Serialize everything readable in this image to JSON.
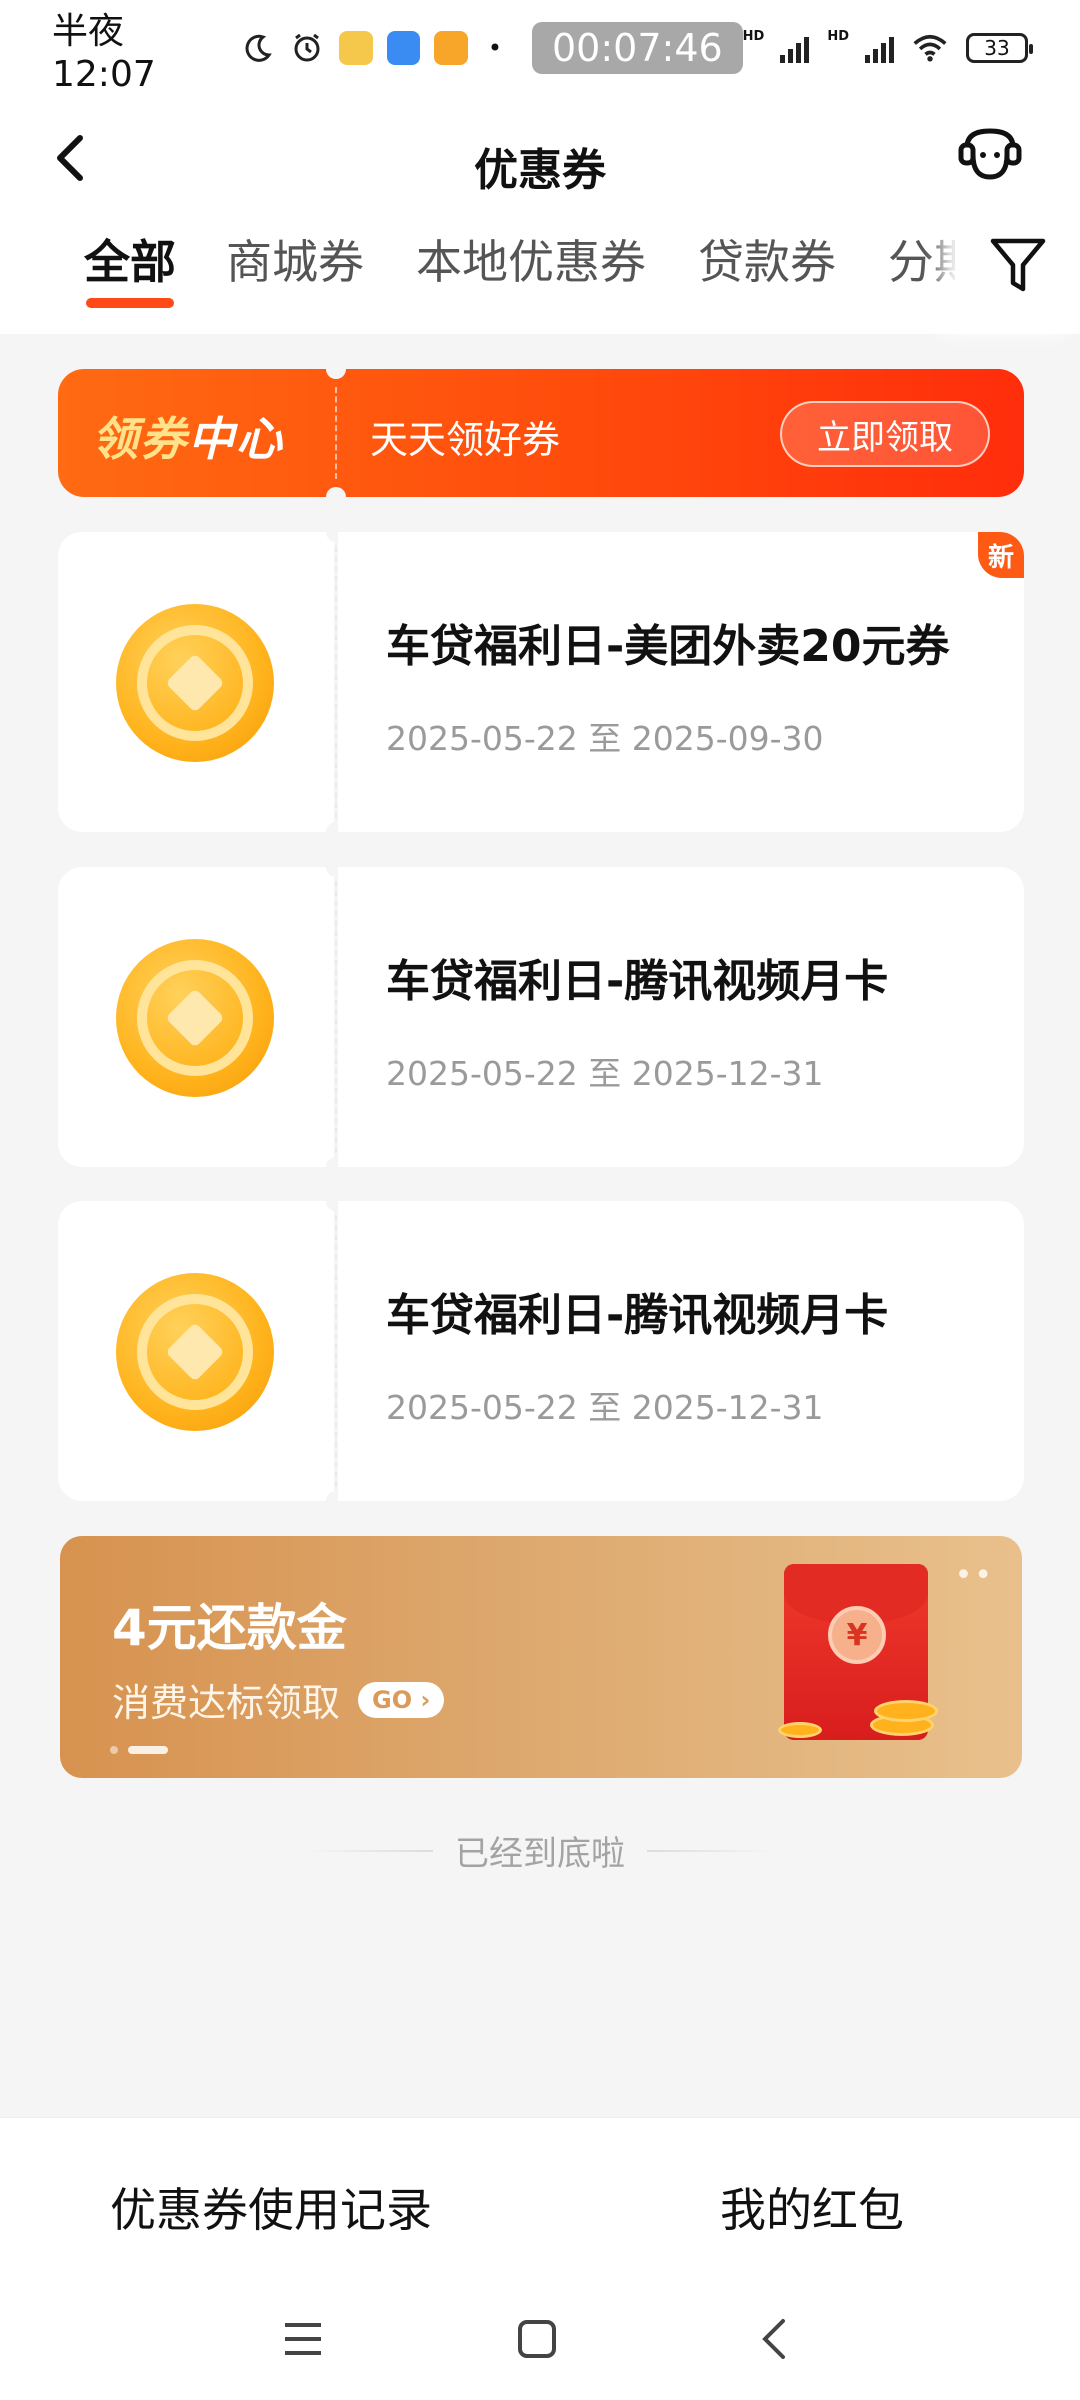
{
  "status_bar": {
    "time": "半夜12:07",
    "timer": "00:07:46",
    "network_label_1": "HD",
    "network_label_2": "HD",
    "battery": "33"
  },
  "header": {
    "title": "优惠券"
  },
  "tabs": [
    {
      "label": "全部",
      "active": true
    },
    {
      "label": "商城券",
      "active": false
    },
    {
      "label": "本地优惠券",
      "active": false
    },
    {
      "label": "贷款券",
      "active": false
    },
    {
      "label": "分期券",
      "active": false
    }
  ],
  "coupon_center": {
    "logo_a": "领券",
    "logo_b": "中心",
    "slogan": "天天领好券",
    "button": "立即领取"
  },
  "coupons": [
    {
      "title": "车贷福利日-美团外卖20元券",
      "date_range": "2025-05-22 至 2025-09-30",
      "badge": "新"
    },
    {
      "title": "车贷福利日-腾讯视频月卡",
      "date_range": "2025-05-22 至 2025-12-31",
      "badge": ""
    },
    {
      "title": "车贷福利日-腾讯视频月卡",
      "date_range": "2025-05-22 至 2025-12-31",
      "badge": ""
    }
  ],
  "repay_banner": {
    "title": "4元还款金",
    "subtitle": "消费达标领取",
    "go": "GO",
    "seal": "¥",
    "more": "••"
  },
  "end_text": "已经到底啦",
  "bottom": {
    "history": "优惠券使用记录",
    "red_packet": "我的红包"
  },
  "colors": {
    "accent": "#ff4a17",
    "coin": "#ffb31c",
    "repay_banner": "#d7924f"
  }
}
